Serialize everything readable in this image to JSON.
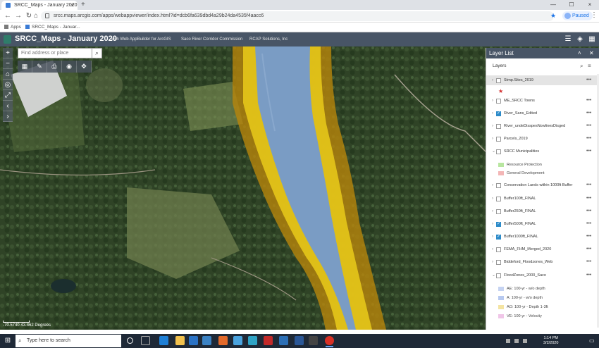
{
  "browser": {
    "tab_title": "SRCC_Maps - January 2020",
    "tab_close": "×",
    "new_tab": "+",
    "controls": [
      "—",
      "☐",
      "×"
    ],
    "url": "srcc.maps.arcgis.com/apps/webappviewer/index.html?id=dcb6fa639dbd4a29b24da4535f4aacc6",
    "profile_label": "Paused",
    "bookmarks": [
      {
        "label": "Apps"
      },
      {
        "label": "SRCC_Maps - Januar..."
      }
    ]
  },
  "app": {
    "title": "SRCC_Maps - January 2020",
    "builder": "with Web AppBuilder for ArcGIS",
    "org": "Saco River Corridor Commission",
    "vendor": "RCAP Solutions, Inc",
    "header_icons": [
      "list-icon",
      "layers-icon",
      "basemap-icon"
    ]
  },
  "map": {
    "search_placeholder": "Find address or place",
    "scale_text": "-70.5740 43.462 Degrees",
    "tools": [
      "basemap-gallery-icon",
      "draw-icon",
      "print-icon",
      "measure-icon",
      "locate-icon"
    ]
  },
  "layer_list": {
    "title": "Layer List",
    "section": "Layers",
    "rows": [
      {
        "label": "Stmp.Sites_2019",
        "checked": false,
        "highlight": true,
        "arrow": "›"
      },
      {
        "label": "ME_SRCC Towns",
        "checked": false,
        "arrow": "›"
      },
      {
        "label": "River_Sans_Edited",
        "checked": true,
        "arrow": "›"
      },
      {
        "label": "River_undeDisspesNowlinesDisged",
        "checked": false,
        "arrow": "›"
      },
      {
        "label": "Parcels_2019",
        "checked": false,
        "arrow": "›"
      },
      {
        "label": "SRCC Municipalities",
        "checked": false,
        "arrow": "⌄"
      },
      {
        "label": "Conservation Lands within 1000ft Buffer",
        "checked": false,
        "arrow": "›"
      },
      {
        "label": "Buffer100ft_FINAL",
        "checked": false,
        "arrow": "›"
      },
      {
        "label": "Buffer250ft_FINAL",
        "checked": false,
        "arrow": "›"
      },
      {
        "label": "Buffer500ft_FINAL",
        "checked": true,
        "arrow": "›"
      },
      {
        "label": "Buffer1000ft_FINAL",
        "checked": true,
        "arrow": "›"
      },
      {
        "label": "FEMA_FHM_Merged_2020",
        "checked": false,
        "arrow": "›"
      },
      {
        "label": "Biddeford_Floodzones_Web",
        "checked": false,
        "arrow": "›"
      },
      {
        "label": "FloodZones_2000_Saco",
        "checked": false,
        "arrow": "⌄"
      }
    ],
    "legend_municipalities": [
      {
        "label": "Resource Protection",
        "color": "#b8e6a0"
      },
      {
        "label": "General Development",
        "color": "#f3b6b6"
      }
    ],
    "legend_floodzones": [
      {
        "label": "AE: 100-yr - w/o depth",
        "color": "#c5d3f2"
      },
      {
        "label": "A: 100-yr - w/o depth",
        "color": "#b7c9f0"
      },
      {
        "label": "AO: 100-yr - Depth 1-3ft",
        "color": "#f4e4a2"
      },
      {
        "label": "VE: 100-yr - Velocity",
        "color": "#f0c6e8"
      }
    ],
    "more": "•••"
  },
  "taskbar": {
    "search_placeholder": "Type here to search",
    "time": "1:14 PM",
    "date": "3/2/2020",
    "apps": [
      {
        "name": "task-view-icon",
        "color": "#1f2937"
      },
      {
        "name": "edge-icon",
        "color": "#1e7fd6"
      },
      {
        "name": "file-explorer-icon",
        "color": "#f2c14e"
      },
      {
        "name": "outlook-icon",
        "color": "#2a72c5"
      },
      {
        "name": "store-icon",
        "color": "#3b82c4"
      },
      {
        "name": "firefox-icon",
        "color": "#e36a2b"
      },
      {
        "name": "onedrive-icon",
        "color": "#4aa3df"
      },
      {
        "name": "snip-icon",
        "color": "#2fa3c6"
      },
      {
        "name": "acrobat-icon",
        "color": "#c32a2a"
      },
      {
        "name": "app-icon",
        "color": "#2c6fb6"
      },
      {
        "name": "word-icon",
        "color": "#2b5797"
      },
      {
        "name": "chrome-icon",
        "color": "#d93025"
      }
    ]
  },
  "colors": {
    "header_bg": "#485566",
    "buffer_1000": "#b8860b",
    "buffer_500": "#e6c619",
    "river": "#7a9cc4"
  }
}
